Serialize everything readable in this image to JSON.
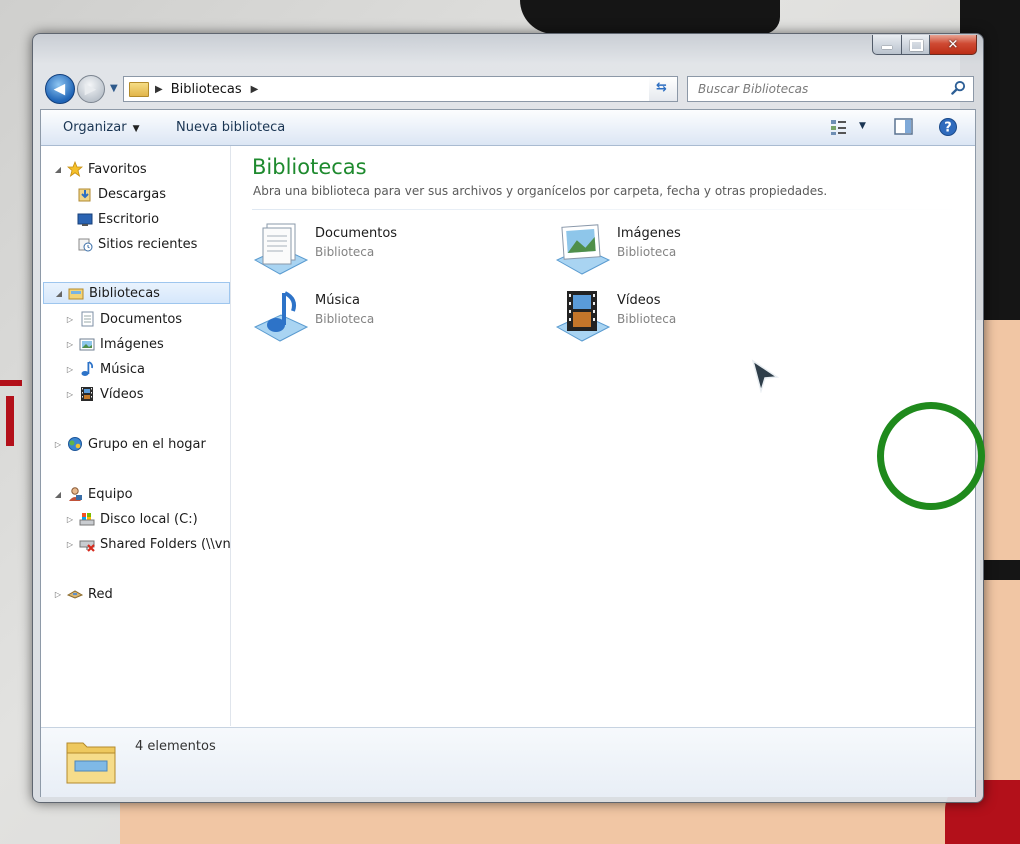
{
  "window": {
    "caption_buttons": {
      "minimize": "minimize",
      "maximize": "maximize",
      "close": "✕"
    }
  },
  "address": {
    "path": "Bibliotecas",
    "search_placeholder": "Buscar Bibliotecas"
  },
  "toolbar": {
    "organize_label": "Organizar",
    "new_library_label": "Nueva biblioteca"
  },
  "navpane": {
    "favorites": {
      "label": "Favoritos",
      "items": [
        "Descargas",
        "Escritorio",
        "Sitios recientes"
      ]
    },
    "libraries": {
      "label": "Bibliotecas",
      "items": [
        "Documentos",
        "Imágenes",
        "Música",
        "Vídeos"
      ]
    },
    "homegroup": {
      "label": "Grupo en el hogar"
    },
    "computer": {
      "label": "Equipo",
      "items": [
        "Disco local (C:)",
        "Shared Folders (\\\\vn"
      ]
    },
    "network": {
      "label": "Red"
    }
  },
  "content": {
    "title": "Bibliotecas",
    "description": "Abra una biblioteca para ver sus archivos y organícelos por carpeta, fecha y otras propiedades.",
    "libraries": [
      {
        "name": "Documentos",
        "type": "Biblioteca",
        "icon": "documents-library-icon"
      },
      {
        "name": "Imágenes",
        "type": "Biblioteca",
        "icon": "pictures-library-icon"
      },
      {
        "name": "Música",
        "type": "Biblioteca",
        "icon": "music-library-icon"
      },
      {
        "name": "Vídeos",
        "type": "Biblioteca",
        "icon": "videos-library-icon"
      }
    ]
  },
  "details": {
    "count": "4 elementos"
  },
  "colors": {
    "title_green": "#1e8a2e",
    "highlight_ring": "#1f8a1c",
    "close_red": "#c8402a",
    "selection_blue": "#d6e7fb"
  }
}
